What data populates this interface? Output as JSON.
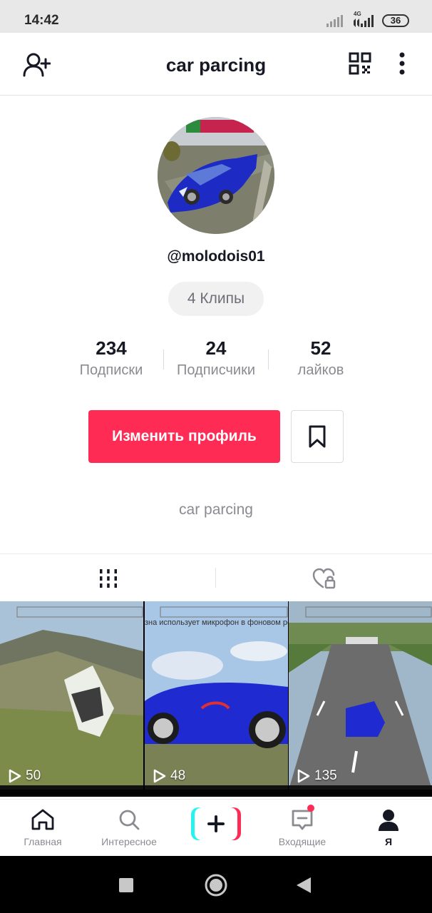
{
  "status_bar": {
    "time": "14:42",
    "network": "4G",
    "battery": "36"
  },
  "header": {
    "title": "car parcing",
    "add_friend_icon": "person-add-icon",
    "qr_icon": "qr-code-icon",
    "menu_icon": "more-vertical-icon"
  },
  "profile": {
    "username": "@molodois01",
    "clips_chip": "4 Клипы",
    "stats": [
      {
        "value": "234",
        "label": "Подписки"
      },
      {
        "value": "24",
        "label": "Подписчики"
      },
      {
        "value": "52",
        "label": "лайков"
      }
    ],
    "edit_button": "Изменить профиль",
    "bio": "car parcing"
  },
  "tabs": [
    {
      "icon": "grid-icon",
      "active": true
    },
    {
      "icon": "liked-locked-icon",
      "active": false
    }
  ],
  "videos": [
    {
      "views": "50",
      "overlay_text": ""
    },
    {
      "views": "48",
      "overlay_text": "зна использует микрофон в фоновом режиме"
    },
    {
      "views": "135",
      "overlay_text": ""
    }
  ],
  "bottom_nav": [
    {
      "label": "Главная",
      "icon": "home-icon",
      "active": false
    },
    {
      "label": "Интересное",
      "icon": "search-icon",
      "active": false
    },
    {
      "label": "",
      "icon": "plus-icon",
      "active": false
    },
    {
      "label": "Входящие",
      "icon": "inbox-icon",
      "active": false,
      "badge": true
    },
    {
      "label": "Я",
      "icon": "profile-icon",
      "active": true
    }
  ],
  "colors": {
    "accent": "#fe2c55",
    "text": "#161823",
    "muted": "#8a8b91",
    "cyan": "#25f4ee"
  }
}
